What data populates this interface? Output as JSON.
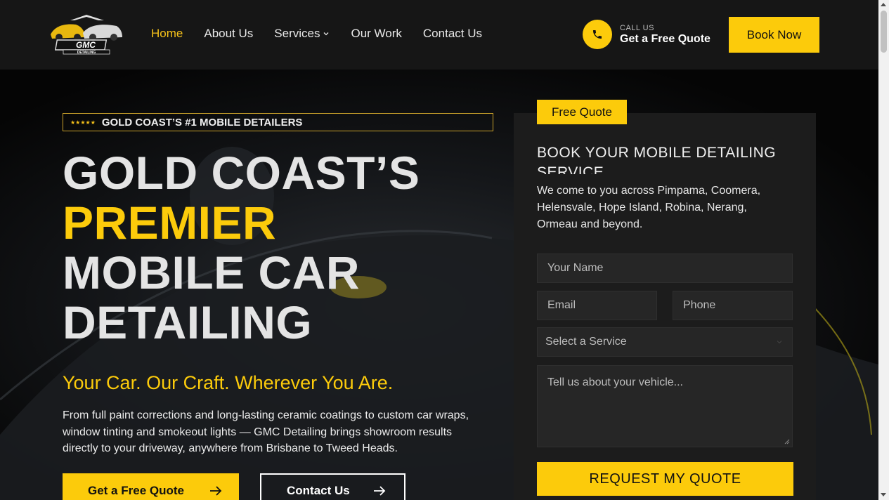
{
  "header": {
    "logo_text": "GMC",
    "logo_subtext": "DETAILING",
    "nav": [
      {
        "label": "Home",
        "active": true
      },
      {
        "label": "About Us"
      },
      {
        "label": "Services",
        "has_dropdown": true
      },
      {
        "label": "Our Work"
      },
      {
        "label": "Contact Us"
      }
    ],
    "call_small": "CALL US",
    "call_big": "Get a Free Quote",
    "book_label": "Book Now"
  },
  "hero": {
    "badge_stars": "★★★★★",
    "badge_text": "GOLD COAST’S #1 MOBILE DETAILERS",
    "headline": [
      "GOLD COAST’S",
      "PREMIER",
      "MOBILE CAR",
      "DETAILING"
    ],
    "tagline": "Your Car. Our Craft. Wherever You Are.",
    "description": "From full paint corrections and long-lasting ceramic coatings to custom car wraps, window tinting and smokeout lights — GMC Detailing brings showroom results directly to your driveway, anywhere from Brisbane to Tweed Heads.",
    "cta_primary": "Get a Free Quote",
    "cta_secondary": "Contact Us"
  },
  "form": {
    "tag": "Free Quote",
    "title": "BOOK YOUR MOBILE DETAILING SERVICE",
    "subtitle": "We come to you across Pimpama, Coomera, Helensvale, Hope Island, Robina, Nerang, Ormeau and beyond.",
    "name_placeholder": "Your Name",
    "email_placeholder": "Email",
    "phone_placeholder": "Phone",
    "service_placeholder": "Select a Service",
    "message_placeholder": "Tell us about your vehicle...",
    "submit_label": "REQUEST MY QUOTE"
  },
  "colors": {
    "accent": "#fccb0b",
    "header_bg": "#161616",
    "card_bg": "#1c1c1c"
  }
}
